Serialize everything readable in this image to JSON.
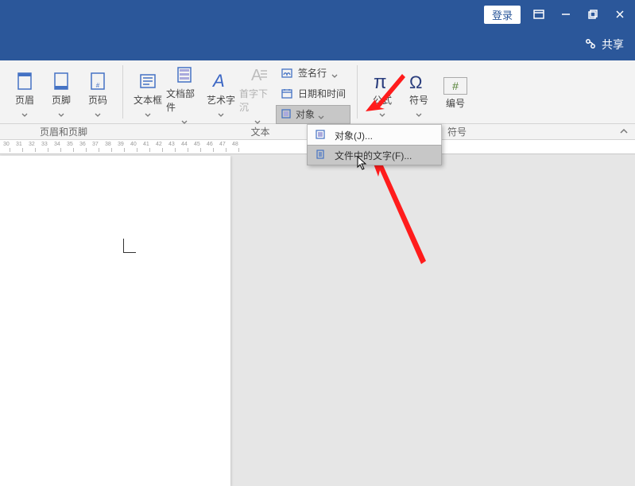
{
  "titlebar": {
    "login": "登录"
  },
  "sharebar": {
    "label": "共享"
  },
  "ribbon": {
    "header_footer": {
      "header": "页眉",
      "footer": "页脚",
      "page_number": "页码"
    },
    "text": {
      "textbox": "文本框",
      "doc_parts": "文档部件",
      "wordart": "艺术字",
      "dropcap": "首字下沉",
      "signature": "签名行",
      "datetime": "日期和时间",
      "object": "对象"
    },
    "symbols": {
      "equation": "公式",
      "symbol": "符号",
      "numbering": "编号",
      "hash": "#"
    }
  },
  "groups": {
    "header_footer": "页眉和页脚",
    "text": "文本",
    "symbols": "符号"
  },
  "dropdown": {
    "object": "对象(J)...",
    "text_from_file": "文件中的文字(F)..."
  },
  "ruler": {
    "marks": [
      "30",
      "31",
      "32",
      "33",
      "34",
      "35",
      "36",
      "37",
      "38",
      "39",
      "40",
      "41",
      "42",
      "43",
      "44",
      "45",
      "46",
      "47",
      "48"
    ]
  }
}
